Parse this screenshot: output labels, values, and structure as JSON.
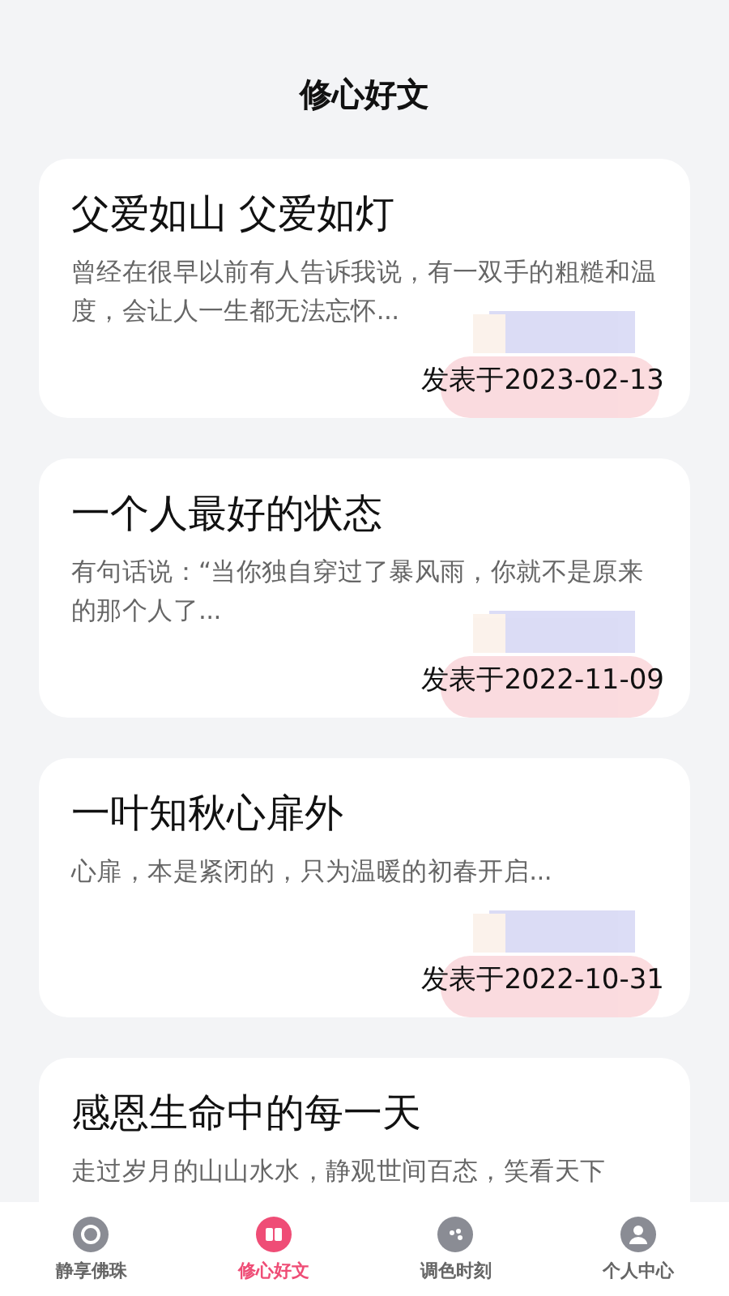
{
  "header": {
    "title": "修心好文"
  },
  "articles": [
    {
      "title": "父爱如山 父爱如灯",
      "summary": "曾经在很早以前有人告诉我说，有一双手的粗糙和温度，会让人一生都无法忘怀...",
      "date": "发表于2023-02-13"
    },
    {
      "title": "一个人最好的状态",
      "summary": "有句话说：“当你独自穿过了暴风雨，你就不是原来的那个人了...",
      "date": "发表于2022-11-09"
    },
    {
      "title": "一叶知秋心扉外",
      "summary": "心扉，本是紧闭的，只为温暖的初春开启...",
      "date": "发表于2022-10-31"
    },
    {
      "title": "感恩生命中的每一天",
      "summary": "走过岁月的山山水水，静观世间百态，笑看天下"
    }
  ],
  "tabs": [
    {
      "label": "静享佛珠",
      "kind": "beads",
      "selected": false
    },
    {
      "label": "修心好文",
      "kind": "book",
      "selected": true
    },
    {
      "label": "调色时刻",
      "kind": "palette",
      "selected": false
    },
    {
      "label": "个人中心",
      "kind": "person",
      "selected": false
    }
  ]
}
